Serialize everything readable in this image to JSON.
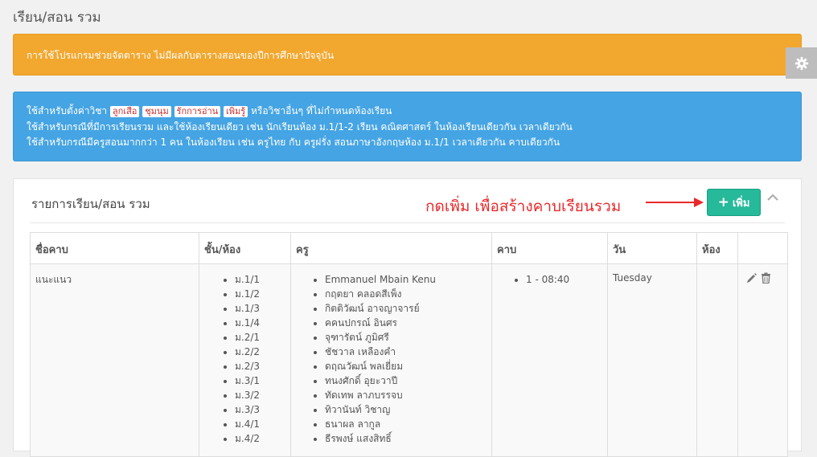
{
  "page": {
    "title": "เรียน/สอน รวม"
  },
  "alerts": {
    "warning": "การใช้โปรแกรมช่วยจัดตาราง ไม่มีผลกับตารางสอนของปีการศึกษาปัจจุบัน",
    "info": {
      "line1_prefix": "ใช้สำหรับตั้งค่าวิชา",
      "tags": [
        "ลูกเสือ",
        "ชุมนุม",
        "รักการอ่าน",
        "เพิ่มรู้"
      ],
      "line1_suffix": "หรือวิชาอื่นๆ ที่ไม่กำหนดห้องเรียน",
      "line2": "ใช้สำหรับกรณีที่มีการเรียนรวม และใช้ห้องเรียนเดียว เช่น นักเรียนห้อง ม.1/1-2 เรียน คณิตศาสตร์ ในห้องเรียนเดียวกัน เวลาเดียวกัน",
      "line3": "ใช้สำหรับกรณีมีครูสอนมากกว่า 1 คน ในห้องเรียน เช่น ครูไทย กับ ครูฝรั่ง สอนภาษาอังกฤษห้อง ม.1/1 เวลาเดียวกัน คาบเดียวกัน"
    }
  },
  "panel": {
    "title": "รายการเรียน/สอน รวม",
    "annotation": "กดเพิ่ม เพื่อสร้างคาบเรียนรวม",
    "add_button": "เพิ่ม",
    "columns": [
      "ชื่อคาบ",
      "ชั้น/ห้อง",
      "ครู",
      "คาบ",
      "วัน",
      "ห้อง",
      ""
    ],
    "row": {
      "name": "แนะแนว",
      "classes": [
        "ม.1/1",
        "ม.1/2",
        "ม.1/3",
        "ม.1/4",
        "ม.2/1",
        "ม.2/2",
        "ม.2/3",
        "ม.3/1",
        "ม.3/2",
        "ม.3/3",
        "ม.4/1",
        "ม.4/2"
      ],
      "teachers": [
        "Emmanuel Mbain Kenu",
        "กฤตยา คลอดสีเพ็ง",
        "กิตติวัฒน์ อาจญาจารย์",
        "คคนปกรณ์ อินศร",
        "จุฑารัตน์ ภูมิศรี",
        "ชัชวาล เหลืองคำ",
        "ดฤณวัฒน์ พลเยี่ยม",
        "ทนงศักดิ์ อุยะวาปี",
        "ทัดเทพ ลาภบรรจบ",
        "ทิวานันท์ วิชาญ",
        "ธนาผล ลากูล",
        "ธีรพงษ์ แสงสิทธิ์"
      ],
      "periods": [
        "1 - 08:40"
      ],
      "day": "Tuesday",
      "room": ""
    }
  },
  "colors": {
    "warning": "#f2a72e",
    "info": "#45a4e3",
    "success": "#26b99a",
    "annotation": "#e8292a"
  },
  "icons": [
    "gear-icon",
    "arrow-right-icon",
    "plus-icon",
    "chevron-up-icon",
    "pencil-icon",
    "trash-icon"
  ]
}
